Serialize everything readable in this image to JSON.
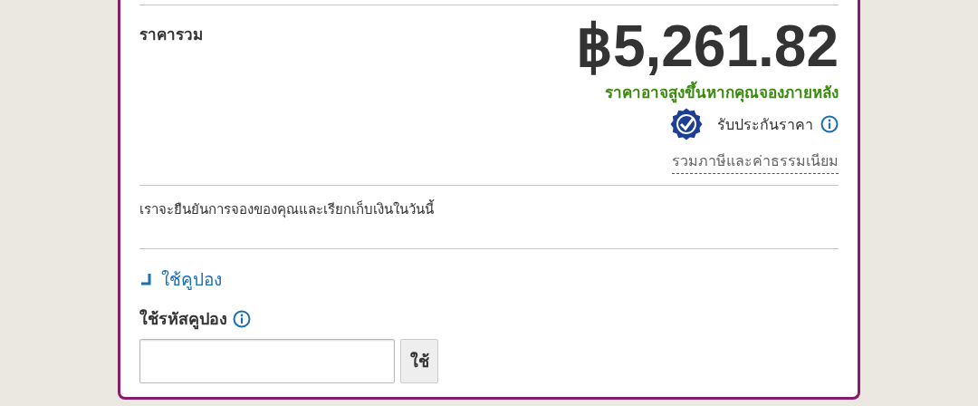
{
  "total": {
    "label": "ราคารวม",
    "price": "฿5,261.82",
    "warning": "ราคาอาจสูงขึ้นหากคุณจองภายหลัง",
    "guarantee": "รับประกันราคา",
    "taxes": "รวมภาษีและค่าธรรมเนียม"
  },
  "notice": "เราจะยืนยันการจองของคุณและเรียกเก็บเงินในวันนี้",
  "coupon": {
    "toggle": "ใช้คูปอง",
    "expanded": true,
    "label": "ใช้รหัสคูปอง",
    "button": "ใช้"
  }
}
